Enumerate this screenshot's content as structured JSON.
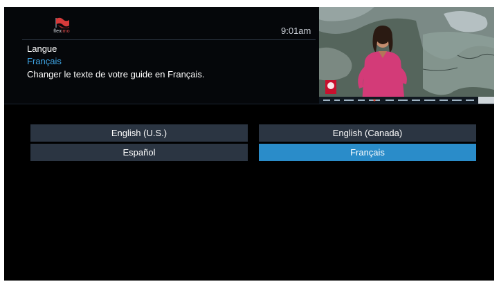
{
  "app": {
    "logo_text_prefix": "flex",
    "logo_text_suffix": "imo",
    "logo_icon": "flag-logo-icon",
    "clock": "9:01am"
  },
  "setting": {
    "title": "Langue",
    "current_value": "Français",
    "description": "Changer le texte de votre guide en Français."
  },
  "preview": {
    "description_icon": "live-tv-preview",
    "channel_logo": "cbc-logo-icon"
  },
  "options": [
    {
      "label": "English (U.S.)",
      "selected": false
    },
    {
      "label": "English (Canada)",
      "selected": false
    },
    {
      "label": "Español",
      "selected": false
    },
    {
      "label": "Français",
      "selected": true
    }
  ],
  "colors": {
    "background": "#000000",
    "option_bg": "#2b3542",
    "option_selected": "#2a8cc9",
    "accent_text": "#3fa7e8",
    "logo_red": "#e04a4a"
  }
}
